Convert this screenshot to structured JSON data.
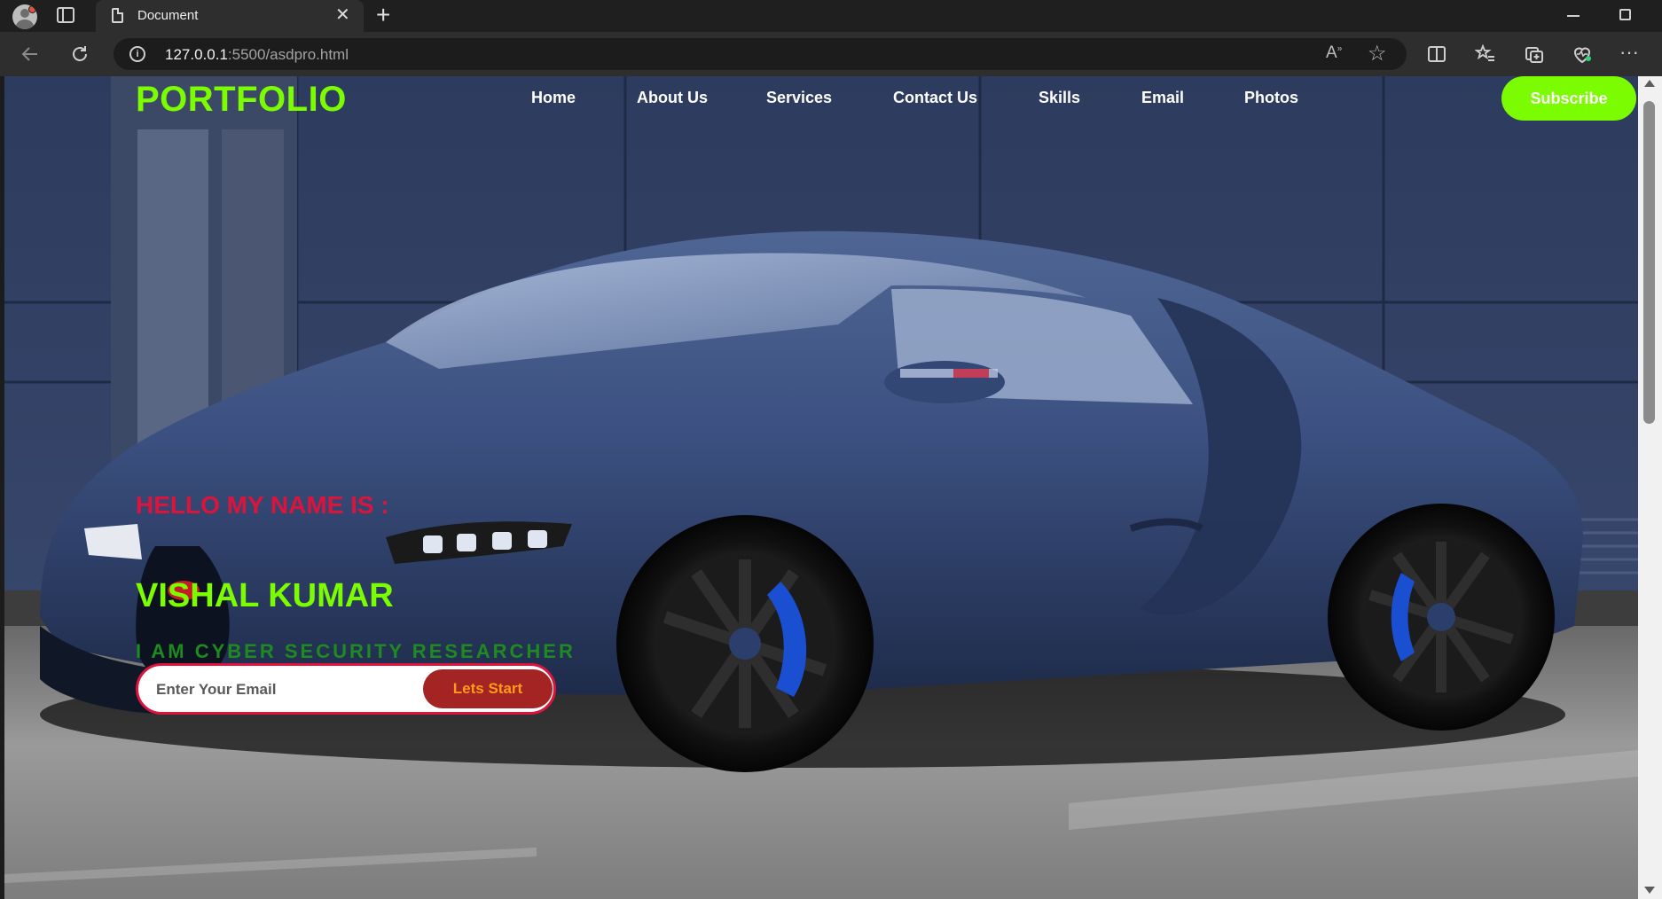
{
  "browser": {
    "tab_title": "Document",
    "url_host": "127.0.0.1",
    "url_rest": ":5500/asdpro.html",
    "icons": [
      "profile-icon",
      "tab-actions-icon",
      "page-icon",
      "close-icon",
      "new-tab-icon",
      "minimize-icon",
      "maximize-icon",
      "back-icon",
      "refresh-icon",
      "info-icon",
      "read-aloud-icon",
      "favorite-icon",
      "split-screen-icon",
      "favorites-icon",
      "collections-icon",
      "health-icon",
      "more-icon"
    ]
  },
  "page": {
    "logo": "PORTFOLIO",
    "nav": [
      "Home",
      "About Us",
      "Services",
      "Contact Us",
      "Skills",
      "Email",
      "Photos"
    ],
    "subscribe_label": "Subscribe",
    "hello": "HELLO MY NAME IS :",
    "name": "VISHAL KUMAR",
    "role": "I AM CYBER SECURITY RESEARCHER",
    "email_placeholder": "Enter Your Email",
    "start_label": "Lets Start",
    "colors": {
      "accent_green": "#7cfc00",
      "accent_red": "#dc143c",
      "button_red": "#a42323",
      "button_text": "#ff9a1a",
      "role_green": "#1f8a1f"
    }
  }
}
